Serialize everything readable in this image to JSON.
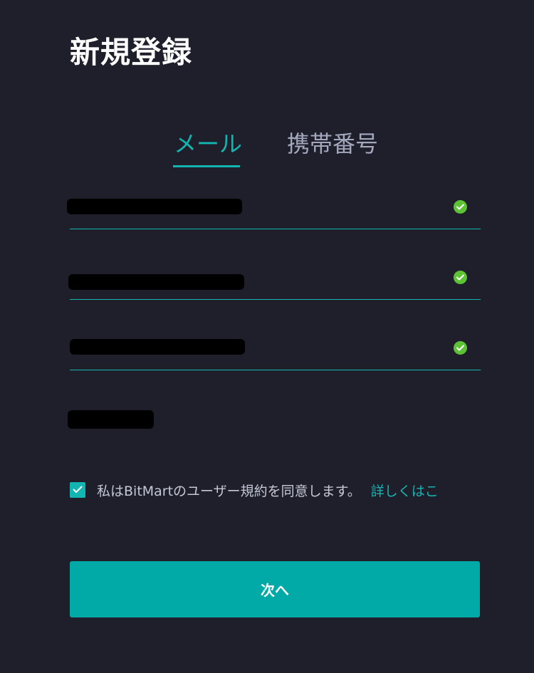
{
  "header": {
    "title": "新規登録"
  },
  "tabs": [
    {
      "label": "メール",
      "active": true
    },
    {
      "label": "携帯番号",
      "active": false
    }
  ],
  "form": {
    "fields": [
      {
        "name": "email",
        "value": "",
        "validated": true
      },
      {
        "name": "password",
        "value": "",
        "validated": true
      },
      {
        "name": "confirm_password",
        "value": "",
        "validated": true
      },
      {
        "name": "invite_code",
        "value": ""
      }
    ],
    "agreement": {
      "checked": true,
      "text": "私はBitMartのユーザー規約を同意します。",
      "link_label": "詳しくはこ"
    },
    "submit_label": "次へ"
  },
  "colors": {
    "background": "#1e1f2b",
    "accent": "#13b5b1",
    "button": "#01aaa6",
    "valid": "#5dc234"
  }
}
